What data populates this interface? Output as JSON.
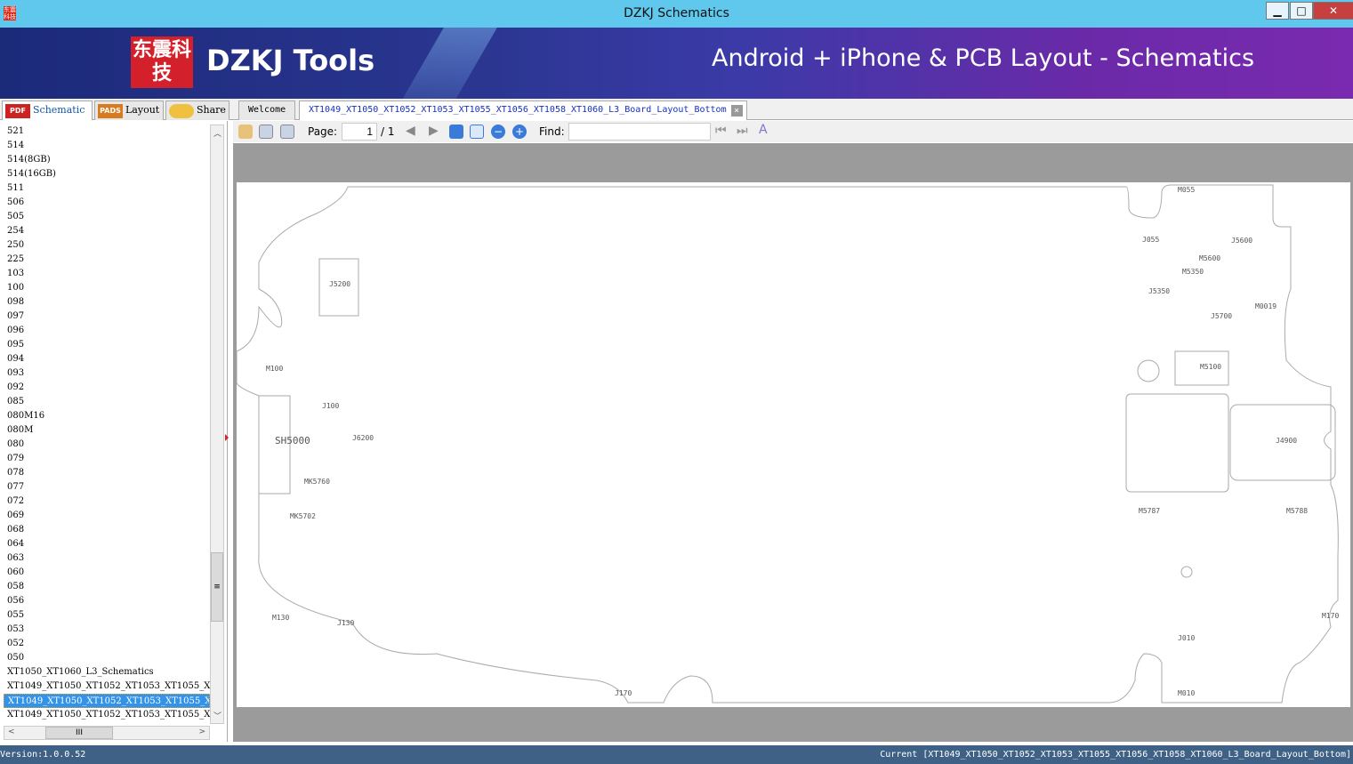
{
  "window": {
    "title": "DZKJ Schematics",
    "app_icon": "dzkj-icon"
  },
  "banner": {
    "logo_text": "东震科技",
    "brand": "DZKJ Tools",
    "slogan": "Android + iPhone & PCB Layout - Schematics"
  },
  "left_tabs": [
    {
      "label": "Schematic",
      "icon": "PDF"
    },
    {
      "label": "Layout",
      "icon": "PADS"
    },
    {
      "label": "Share",
      "icon": "cloud"
    }
  ],
  "doc_tabs": [
    {
      "label": "Welcome"
    },
    {
      "label": "XT1049_XT1050_XT1052_XT1053_XT1055_XT1056_XT1058_XT1060_L3_Board_Layout_Bottom",
      "active": true
    }
  ],
  "list_items": [
    "521",
    "514",
    "514(8GB)",
    "514(16GB)",
    "511",
    "506",
    "505",
    "254",
    "250",
    "225",
    "103",
    "100",
    "098",
    "097",
    "096",
    "095",
    "094",
    "093",
    "092",
    "085",
    "080M16",
    "080M",
    "080",
    "079",
    "078",
    "077",
    "072",
    "069",
    "068",
    "064",
    "063",
    "060",
    "058",
    "056",
    "055",
    "053",
    "052",
    "050",
    "XT1050_XT1060_L3_Schematics",
    "XT1049_XT1050_XT1052_XT1053_XT1055_XT1",
    "XT1049_XT1050_XT1052_XT1053_XT1055_XT1",
    "XT1049_XT1050_XT1052_XT1053_XT1055_XT1"
  ],
  "selected_index": 40,
  "toolbar": {
    "page_label": "Page:",
    "page_value": "1",
    "page_total": "/ 1",
    "find_label": "Find:",
    "find_value": ""
  },
  "board": {
    "labels": [
      "J5200",
      "M100",
      "J100",
      "SH5000",
      "J6200",
      "MK5760",
      "MK5702",
      "M130",
      "J130",
      "J170",
      "M055",
      "J055",
      "J5600",
      "M5600",
      "M5350",
      "J5350",
      "J5700",
      "M0019",
      "M5100",
      "J4900",
      "M5787",
      "M5788",
      "J010",
      "M010",
      "M170"
    ]
  },
  "status": {
    "version": "Version:1.0.0.52",
    "current": "Current [XT1049_XT1050_XT1052_XT1053_XT1055_XT1056_XT1058_XT1060_L3_Board_Layout_Bottom]"
  }
}
